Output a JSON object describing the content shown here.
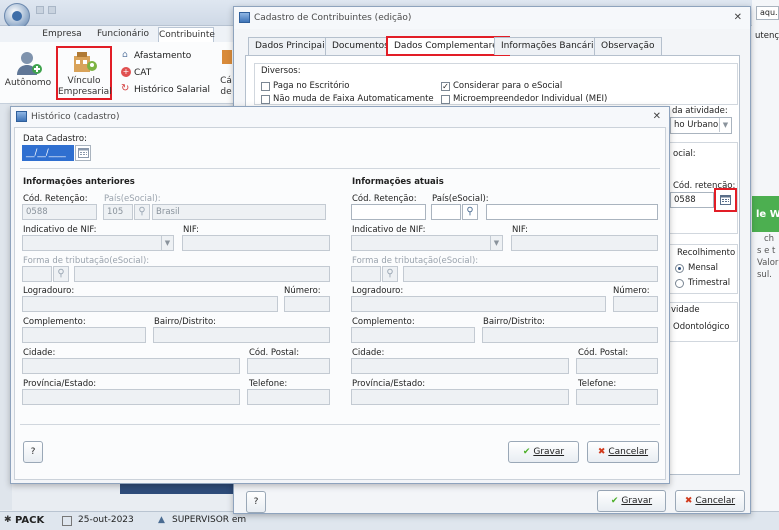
{
  "app": {
    "ribbon_tabs": [
      "Empresa",
      "Funcionário",
      "Contribuinte"
    ],
    "ribbon_buttons": {
      "autonomo": "Autônomo",
      "vinculo_line1": "Vínculo",
      "vinculo_line2": "Empresarial",
      "afastamento": "Afastamento",
      "cat": "CAT",
      "historico_salarial": "Histórico Salarial",
      "cut_label1": "Cá",
      "cut_label2": "de"
    },
    "right_edge": {
      "top_text": "aqu...",
      "tab_text": "utenç",
      "green_text": "le W",
      "info1": "ch",
      "info2": "s e t",
      "info3": "Valor",
      "info4": "sul."
    },
    "status_bar": {
      "brand": "PACK",
      "date": "25-out-2023",
      "user": "SUPERVISOR em"
    }
  },
  "bg_window": {
    "title": "Cadastro de Contribuintes (edição)",
    "tabs": [
      "Dados Principais",
      "Documentos",
      "Dados Complementares",
      "Informações Bancárias",
      "Observação"
    ],
    "active_tab": "Dados Complementares",
    "diversos": {
      "group_label": "Diversos:",
      "items": [
        {
          "label": "Paga no Escritório",
          "checked": false
        },
        {
          "label": "Considerar para o eSocial",
          "checked": true
        },
        {
          "label": "Não muda de Faixa Automaticamente",
          "checked": false
        },
        {
          "label": "Microempreendedor Individual (MEI)",
          "checked": false
        }
      ]
    },
    "right_panel": {
      "atividade_label": "da atividade:",
      "atividade_value": "ho Urbano",
      "social_label": "ocial:",
      "cod_retencao_label": "Cód. retenção:",
      "cod_retencao_value": "0588",
      "recolhimento_label": "Recolhimento",
      "recolhimento_options": [
        "Mensal",
        "Trimestral"
      ],
      "recolhimento_selected": "Mensal",
      "vidade_label": "vidade",
      "odonto_label": "Odontológico"
    },
    "help_label": "?",
    "save_label": "Gravar",
    "cancel_label": "Cancelar"
  },
  "dialog": {
    "title": "Histórico (cadastro)",
    "data_cadastro_label": "Data Cadastro:",
    "data_cadastro_value": "__/__/____",
    "anteriores": {
      "heading": "Informações anteriores",
      "cod_retencao_label": "Cód. Retenção:",
      "cod_retencao_value": "0588",
      "pais_label": "País(eSocial):",
      "pais_code": "105",
      "pais_name": "Brasil",
      "indicativo_nif_label": "Indicativo de NIF:",
      "nif_label": "NIF:",
      "forma_tributacao_label": "Forma de tributação(eSocial):",
      "logradouro_label": "Logradouro:",
      "numero_label": "Número:",
      "complemento_label": "Complemento:",
      "bairro_label": "Bairro/Distrito:",
      "cidade_label": "Cidade:",
      "cod_postal_label": "Cód. Postal:",
      "provincia_label": "Província/Estado:",
      "telefone_label": "Telefone:"
    },
    "atuais": {
      "heading": "Informações atuais",
      "cod_retencao_label": "Cód. Retenção:",
      "pais_label": "País(eSocial):",
      "indicativo_nif_label": "Indicativo de NIF:",
      "nif_label": "NIF:",
      "forma_tributacao_label": "Forma de tributação(eSocial):",
      "logradouro_label": "Logradouro:",
      "numero_label": "Número:",
      "complemento_label": "Complemento:",
      "bairro_label": "Bairro/Distrito:",
      "cidade_label": "Cidade:",
      "cod_postal_label": "Cód. Postal:",
      "provincia_label": "Província/Estado:",
      "telefone_label": "Telefone:"
    },
    "help_label": "?",
    "save_label": "Gravar",
    "cancel_label": "Cancelar"
  },
  "icons": [
    "app-orb-icon",
    "user-add-icon",
    "vinculo-icon",
    "afastamento-icon",
    "cat-icon",
    "historico-salarial-icon",
    "window-icon",
    "search-icon",
    "calendar-icon",
    "check-icon",
    "cancel-x-icon"
  ],
  "colors": {
    "highlight_red": "#e21d26",
    "date_selection": "#2f6fd0",
    "save_check_green": "#4caf2a",
    "cancel_x_red": "#d13a1c"
  }
}
